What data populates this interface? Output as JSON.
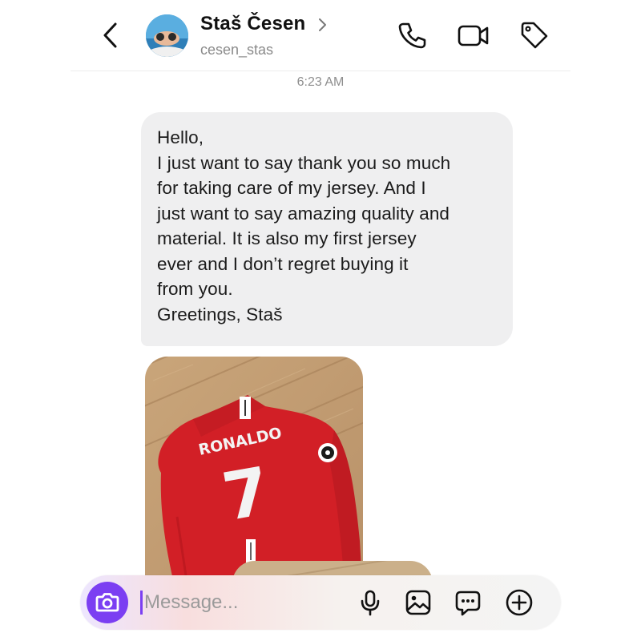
{
  "header": {
    "contact_name": "Staš Česen",
    "username": "cesen_stas",
    "icons": [
      "back-arrow-icon",
      "phone-icon",
      "video-camera-icon",
      "tag-icon"
    ]
  },
  "thread": {
    "timestamp": "6:23 AM",
    "message_lines": [
      "Hello,",
      "I just want to say thank you so much",
      "for taking care of my jersey. And I",
      "just want to say amazing quality and",
      "material. It is also my first jersey",
      "ever and I don’t regret buying it",
      "from you.",
      "Greetings, Staš"
    ],
    "photo": {
      "jersey_name": "RONALDO",
      "jersey_number": "7"
    }
  },
  "composer": {
    "placeholder": "Message...",
    "value": "",
    "icons": [
      "camera-icon",
      "microphone-icon",
      "gallery-icon",
      "sticker-icon",
      "add-icon"
    ]
  },
  "colors": {
    "accent": "#7b3ff2",
    "bubble": "#efeff0",
    "jersey_red": "#d21f26"
  }
}
